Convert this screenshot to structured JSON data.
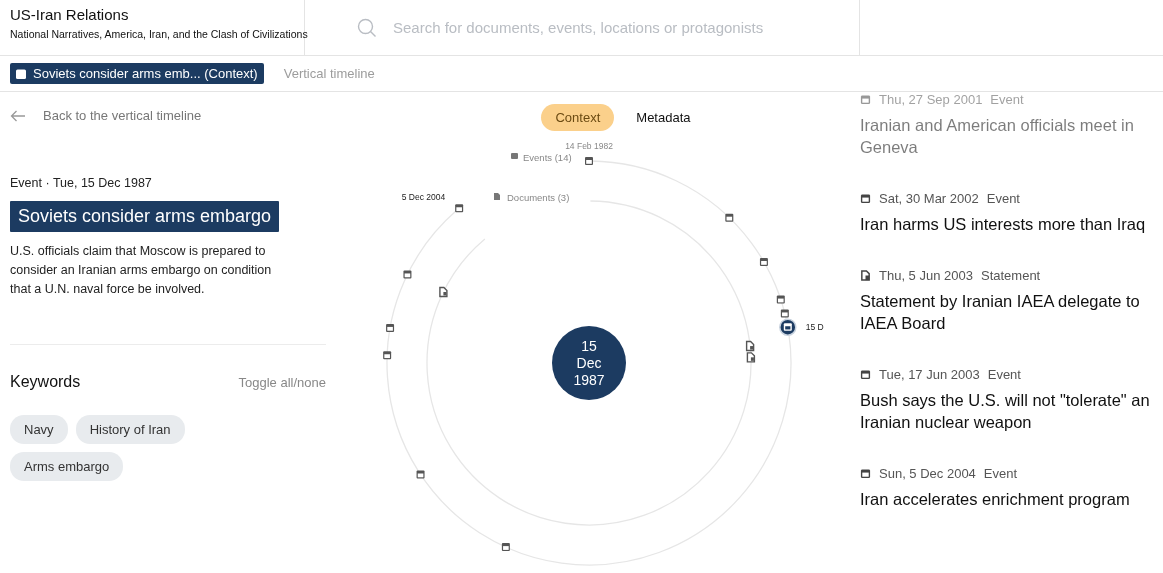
{
  "header": {
    "title": "US-Iran Relations",
    "subtitle": "National Narratives, America, Iran, and the Clash of Civilizations",
    "search": {
      "placeholder": "Search for documents, events, locations or protagonists"
    }
  },
  "breadcrumbs": [
    {
      "label": "Soviets consider arms emb... (Context)",
      "selected": true,
      "kind": "event"
    },
    {
      "label": "Vertical timeline",
      "selected": false,
      "kind": "plain"
    }
  ],
  "back_link": "Back to the vertical timeline",
  "detail": {
    "type": "Event",
    "separator": "·",
    "date": "Tue, 15 Dec 1987",
    "title": "Soviets consider arms embargo",
    "description": "U.S. officials claim that Moscow is prepared to consider an Iranian arms embargo on condition that a U.N. naval force be involved."
  },
  "keywords": {
    "heading": "Keywords",
    "toggle": "Toggle all/none",
    "tags": [
      "Navy",
      "History of Iran",
      "Arms embargo"
    ]
  },
  "view_tabs": [
    {
      "label": "Context",
      "selected": true
    },
    {
      "label": "Metadata",
      "selected": false
    }
  ],
  "radial": {
    "center_lines": [
      "15",
      "Dec",
      "1987"
    ],
    "events_label": "Events (14)",
    "documents_label": "Documents (3)",
    "events": [
      {
        "label": "14 Feb 1982",
        "selected": false
      },
      {
        "selected": false
      },
      {
        "selected": false
      },
      {
        "selected": false
      },
      {
        "selected": false
      },
      {
        "label": "15 D",
        "selected": true
      },
      {
        "selected": false
      },
      {
        "selected": false
      },
      {
        "selected": false
      },
      {
        "selected": false
      },
      {
        "selected": false
      },
      {
        "label": "5 Dec 2004",
        "selected": false
      }
    ],
    "documents": [
      {
        "selected": false
      },
      {
        "selected": false
      },
      {
        "selected": false
      }
    ]
  },
  "timeline": [
    {
      "kind": "event",
      "dimmed": true,
      "date": "Thu, 27 Sep 2001",
      "type": "Event",
      "title": "Iranian and American officials meet in Geneva"
    },
    {
      "kind": "event",
      "dimmed": false,
      "date": "Sat, 30 Mar 2002",
      "type": "Event",
      "title": "Iran harms US interests more than Iraq"
    },
    {
      "kind": "document",
      "dimmed": false,
      "date": "Thu, 5 Jun 2003",
      "type": "Statement",
      "title": "Statement by Iranian IAEA delegate to IAEA Board"
    },
    {
      "kind": "event",
      "dimmed": false,
      "date": "Tue, 17 Jun 2003",
      "type": "Event",
      "title": "Bush says the U.S. will not \"tolerate\" an Iranian nuclear weapon"
    },
    {
      "kind": "event",
      "dimmed": false,
      "date": "Sun, 5 Dec 2004",
      "type": "Event",
      "title": "Iran accelerates enrichment program"
    }
  ]
}
